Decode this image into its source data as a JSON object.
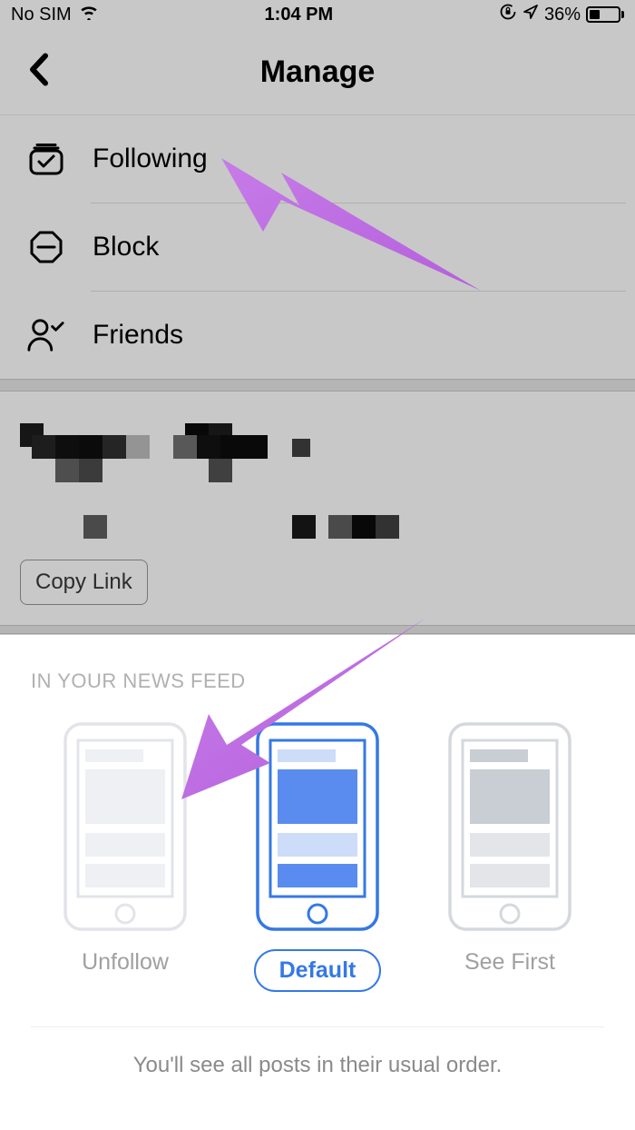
{
  "status_bar": {
    "carrier": "No SIM",
    "time": "1:04 PM",
    "battery_pct": "36%"
  },
  "header": {
    "title": "Manage"
  },
  "menu": {
    "following": "Following",
    "block": "Block",
    "friends": "Friends"
  },
  "link_section": {
    "copy_link": "Copy Link"
  },
  "sheet": {
    "heading": "IN YOUR NEWS FEED",
    "option_unfollow": "Unfollow",
    "option_default": "Default",
    "option_see_first": "See First",
    "description": "You'll see all posts in their usual order."
  }
}
